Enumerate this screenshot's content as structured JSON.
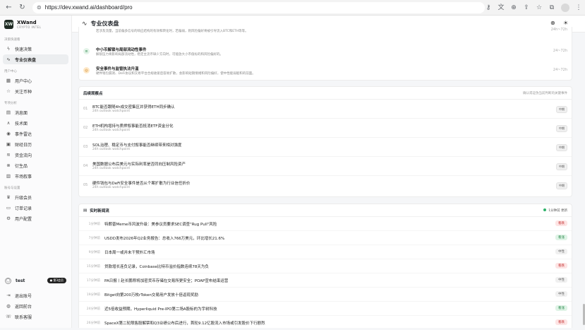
{
  "browser": {
    "url": "https://dev.xwand.ai/dashboard/pro"
  },
  "brand": {
    "name": "XWand",
    "sub": "CRYPTO INTEL",
    "mark": "XW"
  },
  "sidebar": {
    "sections": [
      {
        "title": "决策快速看",
        "items": [
          {
            "label": "快速决策",
            "icon": "bolt-icon"
          },
          {
            "label": "专业仪表盘",
            "icon": "pulse-icon",
            "active": true
          }
        ]
      },
      {
        "title": "用户中心",
        "items": [
          {
            "label": "用户中心",
            "icon": "grid-icon"
          },
          {
            "label": "关注币种",
            "icon": "star-icon"
          }
        ]
      },
      {
        "title": "专项分析",
        "items": [
          {
            "label": "消息面",
            "icon": "doc-icon"
          },
          {
            "label": "技术面",
            "icon": "chart-icon"
          },
          {
            "label": "事件雷达",
            "icon": "radar-icon"
          },
          {
            "label": "财经日历",
            "icon": "calendar-icon"
          },
          {
            "label": "资金流向",
            "icon": "flow-icon"
          },
          {
            "label": "衍生品",
            "icon": "derivative-icon"
          },
          {
            "label": "市场叙事",
            "icon": "book-icon"
          }
        ]
      },
      {
        "title": "账号与设置",
        "items": [
          {
            "label": "升级会员",
            "icon": "crown-icon"
          },
          {
            "label": "订单记录",
            "icon": "order-icon"
          },
          {
            "label": "用户配置",
            "icon": "gear-icon"
          }
        ]
      }
    ],
    "user": {
      "name": "test",
      "badge": "● 第3会员"
    },
    "bottom": [
      {
        "label": "退出账号",
        "icon": "logout-icon"
      },
      {
        "label": "返回前台",
        "icon": "globe-icon"
      },
      {
        "label": "联系客服",
        "icon": "support-icon"
      }
    ]
  },
  "header": {
    "title": "专业仪表盘"
  },
  "alerts": [
    {
      "icon": "!",
      "title": "",
      "desc": "若涉及流量，当前偏多信号的响应结构的有效和转化时，若偏弱，则风险偏好将被引导流入BTC和ETH等等。",
      "time": "24h~72h",
      "color": "#fde8c8",
      "fg": "#c97a12"
    },
    {
      "icon": "≡",
      "title": "中小币解锁与局部流动性事件",
      "desc": "解锁压力将影响局部流动性，稳定主流币缺少方向时，可能放大小市值标的和风险偏好的。",
      "time": "24~72h",
      "color": "#e3f3e8",
      "fg": "#2b8a4d"
    },
    {
      "icon": "◎",
      "title": "安全事件与监管执法升温",
      "desc": "硬件钱包漏洞、DeFi协议和交易平台合规收紧后容易扩散，会影响短期情绪和风险偏好，使中性能弱能和的前面。",
      "time": "24~72h",
      "color": "#fde8c8",
      "fg": "#c97a12"
    }
  ],
  "watch": {
    "title": "后续观察点",
    "note": "确认或证伪当前判断的关键事件",
    "items": [
      {
        "num": "01",
        "title": "BTC能否跟随4h成交密集区并获得ETH同步确认",
        "sub": "24h outlook watchpoint",
        "tag": "中期"
      },
      {
        "num": "02",
        "title": "ETH机构增持与质押叙事能否抵消ETF资金分化",
        "sub": "24h outlook watchpoint",
        "tag": "中期"
      },
      {
        "num": "03",
        "title": "SOL治理、稳定币与支付叙事能否继续带来相对强度",
        "sub": "24h outlook watchpoint",
        "tag": "中期"
      },
      {
        "num": "04",
        "title": "美国数据公布后美元与实际利率是否同向压制风险资产",
        "sub": "24h outlook watchpoint",
        "tag": "中期"
      },
      {
        "num": "05",
        "title": "硬件钱包与DeFi安全事件是否从个案扩散为行业信任折价",
        "sub": "24h outlook watchpoint",
        "tag": "中期"
      }
    ]
  },
  "news": {
    "title": "实时新闻流",
    "status": "1分钟前 更新",
    "items": [
      {
        "time": "1分钟前",
        "title": "特朗普Meme币风波升级：美参议员要求SEC调查\"Rug Pull\"风险",
        "tag": "看跌",
        "kind": "bear"
      },
      {
        "time": "7分钟前",
        "title": "USDD发布2026年Q2业务报告：总收入766万美元，环比增长21.6%",
        "tag": "看涨",
        "kind": "bull"
      },
      {
        "time": "9分钟前",
        "title": "日本周一或并未干预外汇市场",
        "tag": "中性",
        "kind": "neutral"
      },
      {
        "time": "15分钟前",
        "title": "贷款增长连负记录，Coinbase比特币溢价指数连续78天为负",
        "tag": "看跌",
        "kind": "bear"
      },
      {
        "time": "17分钟前",
        "title": "PA日报丨赵长鹏称将加密货币存储在交易所更安全；POAP宣布结束运营",
        "tag": "中性",
        "kind": "neutral"
      },
      {
        "time": "19分钟前",
        "title": "Bitget向第200万枚rToken交易用户发放十倍返现奖励",
        "tag": "中性",
        "kind": "neutral"
      },
      {
        "time": "24分钟前",
        "title": "近5倍收益预期，Hyperliquid Pre-IPO第二场A股标的为宇树科技",
        "tag": "看涨",
        "kind": "bull"
      },
      {
        "time": "26分钟前",
        "title": "SpaceX第二轮限售股解禁和Q3业绩公布后进行，首轮9.12亿股流入市场或引发股价下行剧烈",
        "tag": "看跌",
        "kind": "bear"
      }
    ]
  }
}
